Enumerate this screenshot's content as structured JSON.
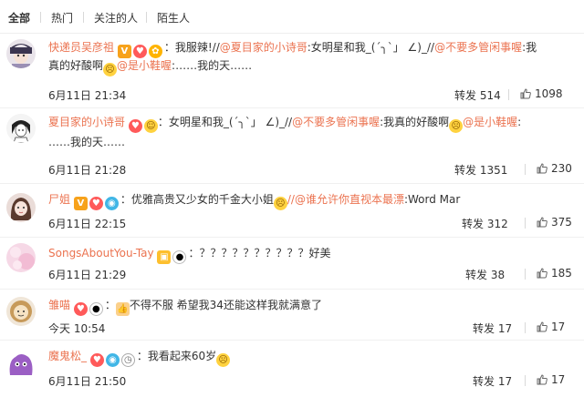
{
  "tabs": [
    "全部",
    "热门",
    "关注的人",
    "陌生人"
  ],
  "repost_label": "转发",
  "comments": [
    {
      "username": "快递员吴彦祖",
      "text_a": "：我服辣!//",
      "link1": "@夏目家的小诗哥",
      "text_b": ":女明星和我_(´╮`」 ∠)_//",
      "link2": "@不要多管闲事喔",
      "text_c": ":我",
      "line2_a": "真的好酸啊",
      "line2_link": "@是小鞋喔",
      "line2_b": ":……我的天……",
      "time": "6月11日 21:34",
      "reposts": "514",
      "likes": "1098"
    },
    {
      "username": "夏目家的小诗哥",
      "text_a": "：女明星和我_(´╮`」 ∠)_//",
      "link1": "@不要多管闲事喔",
      "text_b": ":我真的好酸啊",
      "link2": "@是小鞋喔",
      "text_c": ":",
      "line2_a": "……我的天……",
      "time": "6月11日 21:28",
      "reposts": "1351",
      "likes": "230"
    },
    {
      "username": "尸姐",
      "text_a": "：优雅高贵又少女的千金大小姐",
      "link1": "//@谁允许你直视本最漂",
      "text_b": ":Word Mar",
      "time": "6月11日 22:15",
      "reposts": "312",
      "likes": "375"
    },
    {
      "username": "SongsAboutYou-Tay",
      "text_a": "：？？？？？？？？？？好美",
      "time": "6月11日 21:29",
      "reposts": "38",
      "likes": "185"
    },
    {
      "username": "雏喵",
      "text_a": "不得不服 希望我34还能这样我就满意了",
      "time": "今天 10:54",
      "reposts": "17",
      "likes": "17"
    },
    {
      "username": "魔鬼松_",
      "text_a": "：我看起来60岁",
      "time": "6月11日 21:50",
      "reposts": "17",
      "likes": "17"
    }
  ]
}
